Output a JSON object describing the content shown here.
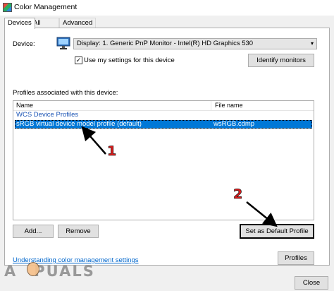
{
  "window": {
    "title": "Color Management"
  },
  "tabs": [
    {
      "label": "Devices",
      "active": true
    },
    {
      "label": "All Profiles",
      "active": false
    },
    {
      "label": "Advanced",
      "active": false
    }
  ],
  "device": {
    "label": "Device:",
    "selected": "Display: 1. Generic PnP Monitor - Intel(R) HD Graphics 530",
    "use_settings_label": "Use my settings for this device",
    "use_settings_checked": true,
    "check_glyph": "✓",
    "caret_glyph": "▾",
    "identify_label": "Identify monitors"
  },
  "profiles": {
    "section_label": "Profiles associated with this device:",
    "columns": {
      "name": "Name",
      "file": "File name"
    },
    "group": "WCS Device Profiles",
    "rows": [
      {
        "name": "sRGB virtual device model profile (default)",
        "file": "wsRGB.cdmp",
        "selected": true
      }
    ]
  },
  "buttons": {
    "add": "Add...",
    "remove": "Remove",
    "set_default": "Set as Default Profile",
    "profiles": "Profiles",
    "close": "Close"
  },
  "link": "Understanding color management settings",
  "annotations": {
    "marker1": "1",
    "marker2": "2",
    "arrow_color": "#000000",
    "number_color": "#d81e1e"
  },
  "watermark": {
    "text_left": "A",
    "text_right": "PUALS"
  },
  "colors": {
    "selection": "#0078d7",
    "link": "#0066cc",
    "accent_group": "#1c55b5"
  }
}
